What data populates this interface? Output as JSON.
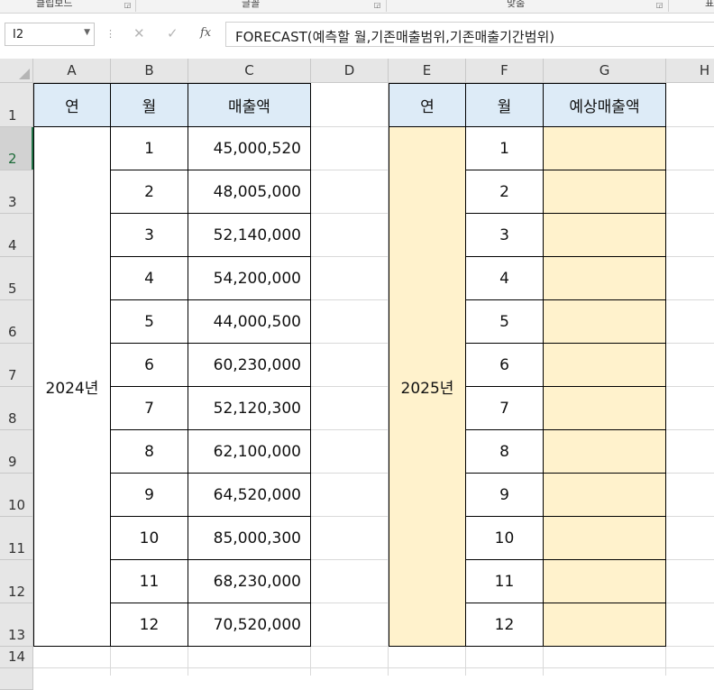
{
  "ribbon": {
    "groups": [
      "클립보드",
      "글꼴",
      "맞춤",
      "표"
    ]
  },
  "formula_bar": {
    "name_box": "I2",
    "cancel_icon": "✕",
    "enter_icon": "✓",
    "fx_label": "fx",
    "formula": "FORECAST(예측할 월,기존매출범위,기존매출기간범위)"
  },
  "columns": [
    "A",
    "B",
    "C",
    "D",
    "E",
    "F",
    "G",
    "H"
  ],
  "rows": [
    "1",
    "2",
    "3",
    "4",
    "5",
    "6",
    "7",
    "8",
    "9",
    "10",
    "11",
    "12",
    "13",
    "14"
  ],
  "selected_row": "2",
  "table_2024": {
    "headers": [
      "연",
      "월",
      "매출액"
    ],
    "year": "2024년",
    "months": [
      "1",
      "2",
      "3",
      "4",
      "5",
      "6",
      "7",
      "8",
      "9",
      "10",
      "11",
      "12"
    ],
    "sales": [
      "45,000,520",
      "48,005,000",
      "52,140,000",
      "54,200,000",
      "44,000,500",
      "60,230,000",
      "52,120,300",
      "62,100,000",
      "64,520,000",
      "85,000,300",
      "68,230,000",
      "70,520,000"
    ]
  },
  "table_2025": {
    "headers": [
      "연",
      "월",
      "예상매출액"
    ],
    "year": "2025년",
    "months": [
      "1",
      "2",
      "3",
      "4",
      "5",
      "6",
      "7",
      "8",
      "9",
      "10",
      "11",
      "12"
    ]
  },
  "colors": {
    "header_fill": "#ddebf7",
    "forecast_fill": "#fff2cc",
    "excel_green": "#217346"
  }
}
